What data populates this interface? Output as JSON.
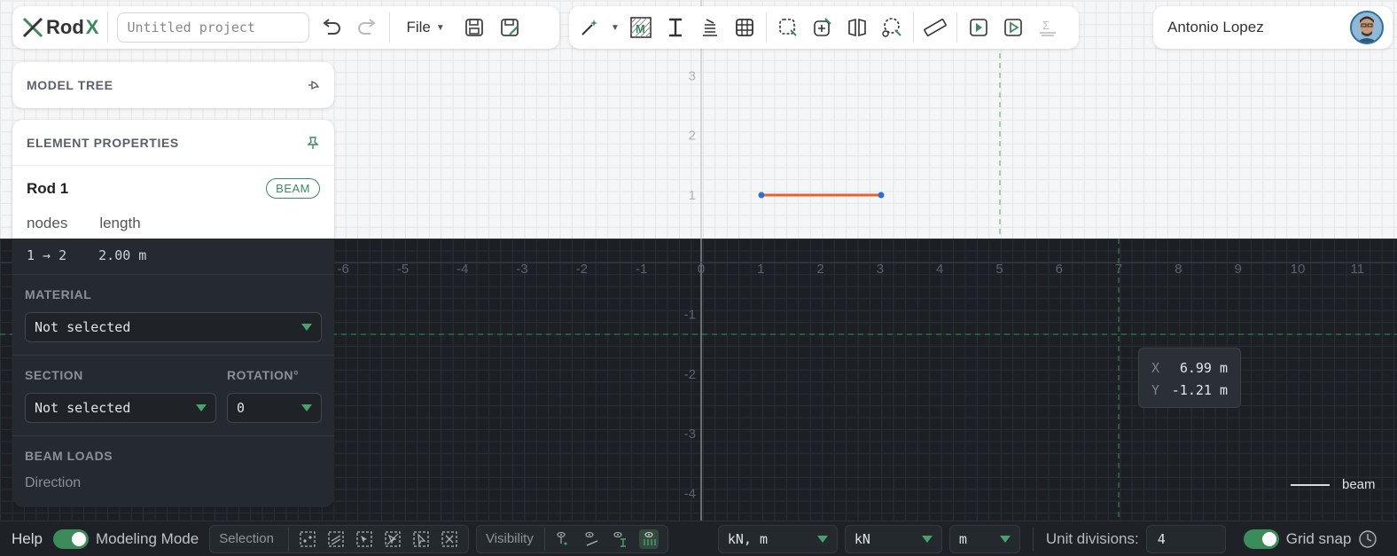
{
  "app": {
    "logo_text": "Rod",
    "logo_accent": "X",
    "accent_color": "#3c8b5a"
  },
  "toolbar": {
    "project_placeholder": "Untitled project",
    "file_label": "File",
    "icons": [
      "undo-icon",
      "redo-icon",
      "save-icon",
      "save-as-icon"
    ]
  },
  "tools": {
    "icons": [
      "magic-wand-icon",
      "material-icon",
      "section-icon",
      "load-icon",
      "table-icon",
      "select-node-icon",
      "add-node-icon",
      "mirror-icon",
      "circle-select-icon",
      "ruler-icon",
      "run-select-icon",
      "run-icon",
      "sum-icon"
    ]
  },
  "user": {
    "name": "Antonio Lopez"
  },
  "model_tree": {
    "title": "MODEL TREE"
  },
  "element_properties": {
    "title": "ELEMENT PROPERTIES",
    "element_name": "Rod 1",
    "element_type": "BEAM",
    "nodes_label": "nodes",
    "length_label": "length",
    "nodes_value": "1 → 2",
    "length_value": "2.00 m",
    "material_label": "MATERIAL",
    "material_value": "Not selected",
    "section_label": "SECTION",
    "section_value": "Not selected",
    "rotation_label": "ROTATION°",
    "rotation_value": "0",
    "beam_loads_label": "BEAM LOADS",
    "direction_label": "Direction"
  },
  "canvas": {
    "x_ticks": [
      "-6",
      "-5",
      "-4",
      "-3",
      "-2",
      "-1",
      "0",
      "1",
      "2",
      "3",
      "4",
      "5",
      "6",
      "7",
      "8",
      "9",
      "10",
      "11"
    ],
    "y_ticks": [
      "3",
      "2",
      "1",
      "-1",
      "-2",
      "-3",
      "-4"
    ],
    "rod_color": "#e8622c",
    "node_color": "#2d6fd6"
  },
  "cursor": {
    "x_label": "X",
    "y_label": "Y",
    "x_value": "6.99 m",
    "y_value": "-1.21 m"
  },
  "legend": {
    "label": "beam"
  },
  "statusbar": {
    "help_label": "Help",
    "modeling_mode_label": "Modeling Mode",
    "selection_label": "Selection",
    "visibility_label": "Visibility",
    "units_value": "kN, m",
    "force_unit_value": "kN",
    "length_unit_value": "m",
    "unit_divisions_label": "Unit divisions:",
    "unit_divisions_value": "4",
    "grid_snap_label": "Grid snap"
  }
}
